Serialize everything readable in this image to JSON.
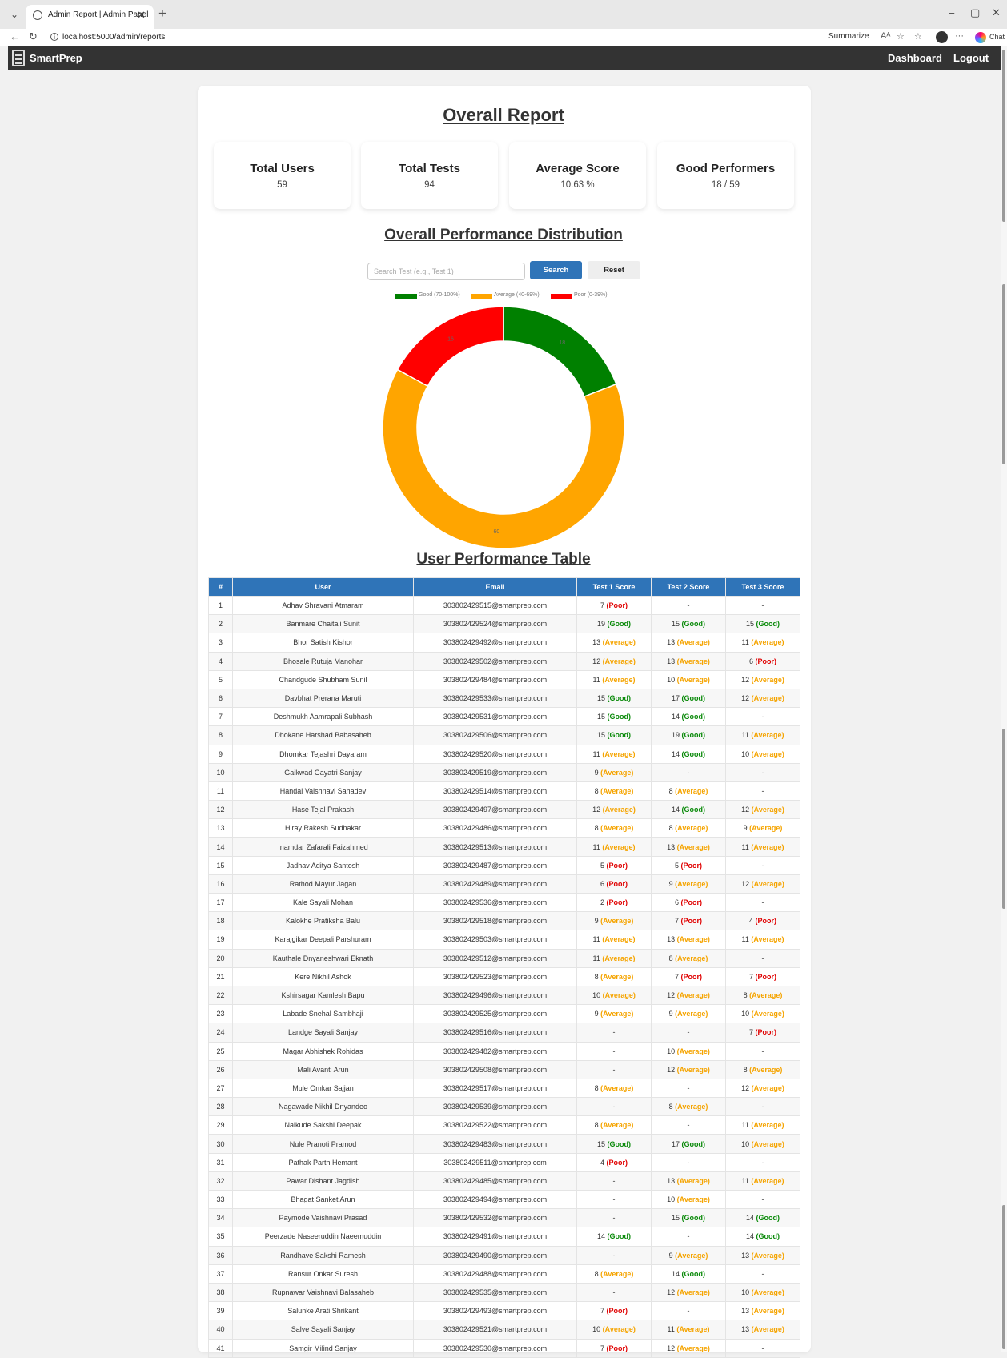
{
  "browser": {
    "tab_title": "Admin Report | Admin Panel",
    "close_glyph": "✕",
    "new_tab_glyph": "+",
    "url": "localhost:5000/admin/reports",
    "summarize_label": "Summarize",
    "chat_label": "Chat"
  },
  "nav": {
    "brand": "SmartPrep",
    "links": [
      "Dashboard",
      "Logout"
    ]
  },
  "report": {
    "title": "Overall Report",
    "stats": [
      {
        "label": "Total Users",
        "value": "59"
      },
      {
        "label": "Total Tests",
        "value": "94"
      },
      {
        "label": "Average Score",
        "value": "10.63 %"
      },
      {
        "label": "Good Performers",
        "value": "18 / 59"
      }
    ]
  },
  "distribution": {
    "title": "Overall Performance Distribution",
    "search_placeholder": "Search Test (e.g., Test 1)",
    "search_label": "Search",
    "reset_label": "Reset"
  },
  "chart_data": {
    "type": "pie",
    "categories": [
      "Good (70-100%)",
      "Average (40-69%)",
      "Poor (0-39%)"
    ],
    "values": [
      18,
      60,
      16
    ],
    "colors": [
      "#008000",
      "#ffa500",
      "#ff0000"
    ],
    "legend_placement": "top",
    "donut": true
  },
  "table": {
    "title": "User Performance Table",
    "headers": [
      "#",
      "User",
      "Email",
      "Test 1 Score",
      "Test 2 Score",
      "Test 3 Score"
    ],
    "rows": [
      [
        "1",
        "Adhav Shravani Atmaram",
        "303802429515@smartprep.com",
        "7 (Poor)",
        "-",
        "-"
      ],
      [
        "2",
        "Banmare Chaitali Sunit",
        "303802429524@smartprep.com",
        "19 (Good)",
        "15 (Good)",
        "15 (Good)"
      ],
      [
        "3",
        "Bhor Satish Kishor",
        "303802429492@smartprep.com",
        "13 (Average)",
        "13 (Average)",
        "11 (Average)"
      ],
      [
        "4",
        "Bhosale Rutuja Manohar",
        "303802429502@smartprep.com",
        "12 (Average)",
        "13 (Average)",
        "6 (Poor)"
      ],
      [
        "5",
        "Chandgude Shubham Sunil",
        "303802429484@smartprep.com",
        "11 (Average)",
        "10 (Average)",
        "12 (Average)"
      ],
      [
        "6",
        "Davbhat Prerana Maruti",
        "303802429533@smartprep.com",
        "15 (Good)",
        "17 (Good)",
        "12 (Average)"
      ],
      [
        "7",
        "Deshmukh Aamrapali Subhash",
        "303802429531@smartprep.com",
        "15 (Good)",
        "14 (Good)",
        "-"
      ],
      [
        "8",
        "Dhokane Harshad Babasaheb",
        "303802429506@smartprep.com",
        "15 (Good)",
        "19 (Good)",
        "11 (Average)"
      ],
      [
        "9",
        "Dhomkar Tejashri Dayaram",
        "303802429520@smartprep.com",
        "11 (Average)",
        "14 (Good)",
        "10 (Average)"
      ],
      [
        "10",
        "Gaikwad Gayatri Sanjay",
        "303802429519@smartprep.com",
        "9 (Average)",
        "-",
        "-"
      ],
      [
        "11",
        "Handal Vaishnavi Sahadev",
        "303802429514@smartprep.com",
        "8 (Average)",
        "8 (Average)",
        "-"
      ],
      [
        "12",
        "Hase Tejal Prakash",
        "303802429497@smartprep.com",
        "12 (Average)",
        "14 (Good)",
        "12 (Average)"
      ],
      [
        "13",
        "Hiray Rakesh Sudhakar",
        "303802429486@smartprep.com",
        "8 (Average)",
        "8 (Average)",
        "9 (Average)"
      ],
      [
        "14",
        "Inamdar Zafarali Faizahmed",
        "303802429513@smartprep.com",
        "11 (Average)",
        "13 (Average)",
        "11 (Average)"
      ],
      [
        "15",
        "Jadhav Aditya Santosh",
        "303802429487@smartprep.com",
        "5 (Poor)",
        "5 (Poor)",
        "-"
      ],
      [
        "16",
        "Rathod Mayur Jagan",
        "303802429489@smartprep.com",
        "6 (Poor)",
        "9 (Average)",
        "12 (Average)"
      ],
      [
        "17",
        "Kale Sayali Mohan",
        "303802429536@smartprep.com",
        "2 (Poor)",
        "6 (Poor)",
        "-"
      ],
      [
        "18",
        "Kalokhe Pratiksha Balu",
        "303802429518@smartprep.com",
        "9 (Average)",
        "7 (Poor)",
        "4 (Poor)"
      ],
      [
        "19",
        "Karajgikar Deepali Parshuram",
        "303802429503@smartprep.com",
        "11 (Average)",
        "13 (Average)",
        "11 (Average)"
      ],
      [
        "20",
        "Kauthale Dnyaneshwari Eknath",
        "303802429512@smartprep.com",
        "11 (Average)",
        "8 (Average)",
        "-"
      ],
      [
        "21",
        "Kere Nikhil Ashok",
        "303802429523@smartprep.com",
        "8 (Average)",
        "7 (Poor)",
        "7 (Poor)"
      ],
      [
        "22",
        "Kshirsagar Kamlesh Bapu",
        "303802429496@smartprep.com",
        "10 (Average)",
        "12 (Average)",
        "8 (Average)"
      ],
      [
        "23",
        "Labade Snehal Sambhaji",
        "303802429525@smartprep.com",
        "9 (Average)",
        "9 (Average)",
        "10 (Average)"
      ],
      [
        "24",
        "Landge Sayali Sanjay",
        "303802429516@smartprep.com",
        "-",
        "-",
        "7 (Poor)"
      ],
      [
        "25",
        "Magar Abhishek Rohidas",
        "303802429482@smartprep.com",
        "-",
        "10 (Average)",
        "-"
      ],
      [
        "26",
        "Mali Avanti Arun",
        "303802429508@smartprep.com",
        "-",
        "12 (Average)",
        "8 (Average)"
      ],
      [
        "27",
        "Mule Omkar Sajjan",
        "303802429517@smartprep.com",
        "8 (Average)",
        "-",
        "12 (Average)"
      ],
      [
        "28",
        "Nagawade Nikhil Dnyandeo",
        "303802429539@smartprep.com",
        "-",
        "8 (Average)",
        "-"
      ],
      [
        "29",
        "Naikude Sakshi Deepak",
        "303802429522@smartprep.com",
        "8 (Average)",
        "-",
        "11 (Average)"
      ],
      [
        "30",
        "Nule Pranoti Pramod",
        "303802429483@smartprep.com",
        "15 (Good)",
        "17 (Good)",
        "10 (Average)"
      ],
      [
        "31",
        "Pathak Parth Hemant",
        "303802429511@smartprep.com",
        "4 (Poor)",
        "-",
        "-"
      ],
      [
        "32",
        "Pawar Dishant Jagdish",
        "303802429485@smartprep.com",
        "-",
        "13 (Average)",
        "11 (Average)"
      ],
      [
        "33",
        "Bhagat Sanket Arun",
        "303802429494@smartprep.com",
        "-",
        "10 (Average)",
        "-"
      ],
      [
        "34",
        "Paymode Vaishnavi Prasad",
        "303802429532@smartprep.com",
        "-",
        "15 (Good)",
        "14 (Good)"
      ],
      [
        "35",
        "Peerzade Naseeruddin Naeemuddin",
        "303802429491@smartprep.com",
        "14 (Good)",
        "-",
        "14 (Good)"
      ],
      [
        "36",
        "Randhave Sakshi Ramesh",
        "303802429490@smartprep.com",
        "-",
        "9 (Average)",
        "13 (Average)"
      ],
      [
        "37",
        "Ransur Onkar Suresh",
        "303802429488@smartprep.com",
        "8 (Average)",
        "14 (Good)",
        "-"
      ],
      [
        "38",
        "Rupnawar Vaishnavi Balasaheb",
        "303802429535@smartprep.com",
        "-",
        "12 (Average)",
        "10 (Average)"
      ],
      [
        "39",
        "Salunke Arati Shrikant",
        "303802429493@smartprep.com",
        "7 (Poor)",
        "-",
        "13 (Average)"
      ],
      [
        "40",
        "Salve Sayali Sanjay",
        "303802429521@smartprep.com",
        "10 (Average)",
        "11 (Average)",
        "13 (Average)"
      ],
      [
        "41",
        "Samgir Milind Sanjay",
        "303802429530@smartprep.com",
        "7 (Poor)",
        "12 (Average)",
        "-"
      ]
    ]
  }
}
